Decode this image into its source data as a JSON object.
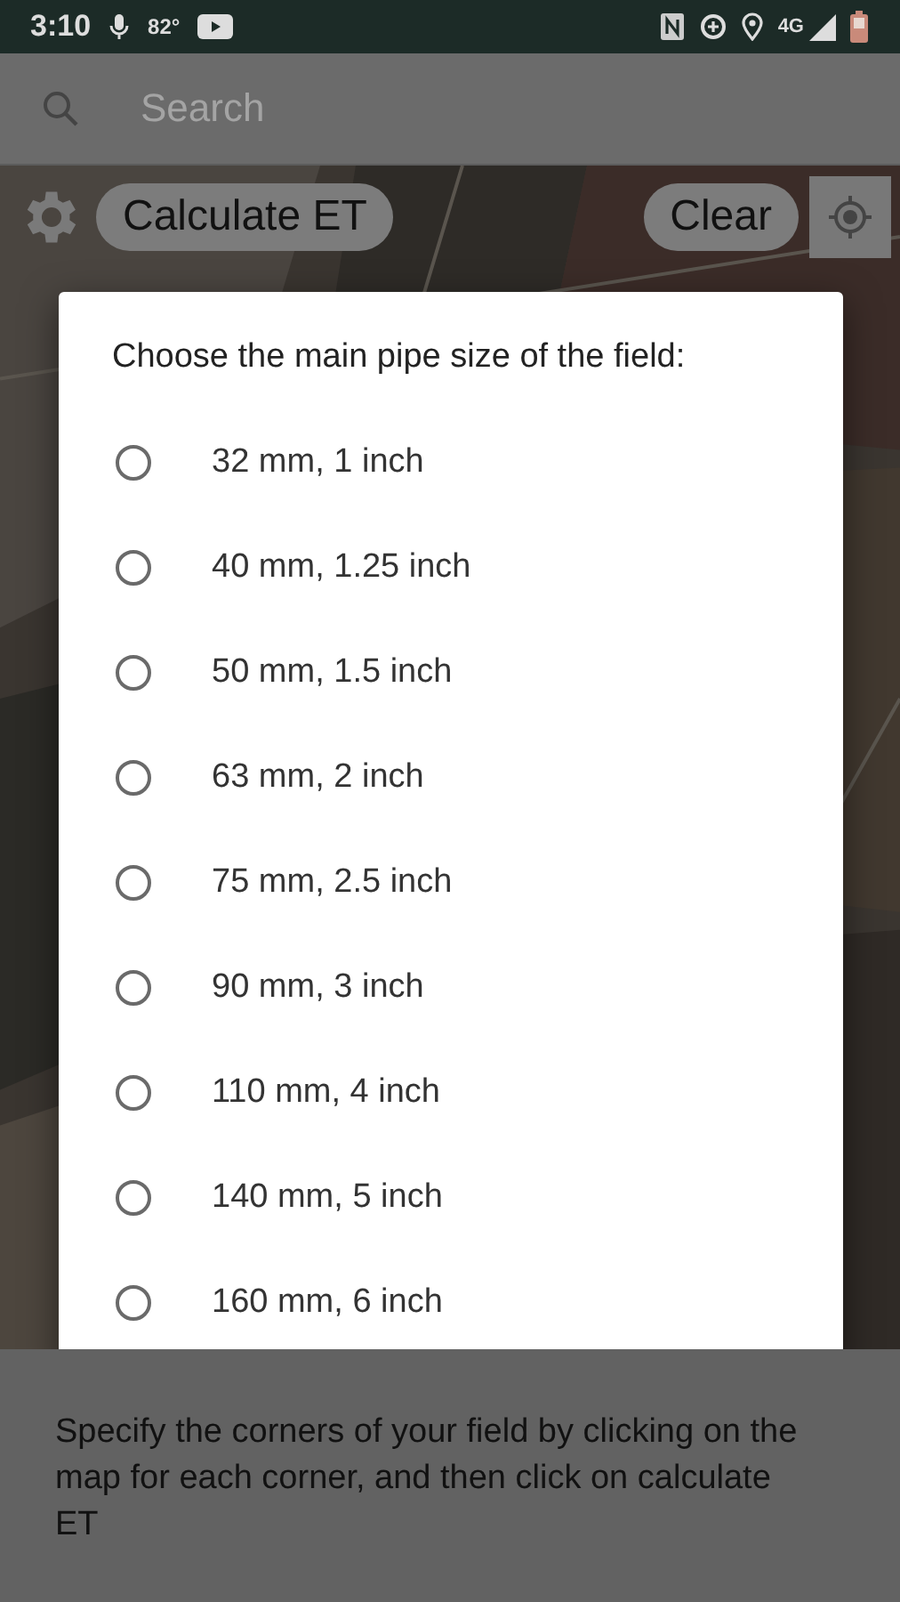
{
  "status_bar": {
    "time": "3:10",
    "temperature": "82°",
    "network": "4G"
  },
  "search": {
    "placeholder": "Search"
  },
  "map_controls": {
    "calculate_button": "Calculate ET",
    "clear_button": "Clear"
  },
  "dialog": {
    "title": "Choose the main pipe size of the field:",
    "options": [
      {
        "label": "32 mm, 1 inch",
        "selected": false
      },
      {
        "label": "40 mm, 1.25 inch",
        "selected": false
      },
      {
        "label": "50 mm, 1.5 inch",
        "selected": false
      },
      {
        "label": "63 mm, 2 inch",
        "selected": false
      },
      {
        "label": "75 mm, 2.5 inch",
        "selected": false
      },
      {
        "label": "90 mm, 3 inch",
        "selected": false
      },
      {
        "label": "110 mm, 4 inch",
        "selected": false
      },
      {
        "label": "140 mm, 5 inch",
        "selected": false
      },
      {
        "label": "160 mm, 6 inch",
        "selected": false
      }
    ]
  },
  "instructions": "Specify the corners of your field by clicking on the map for each corner, and then click on calculate ET"
}
